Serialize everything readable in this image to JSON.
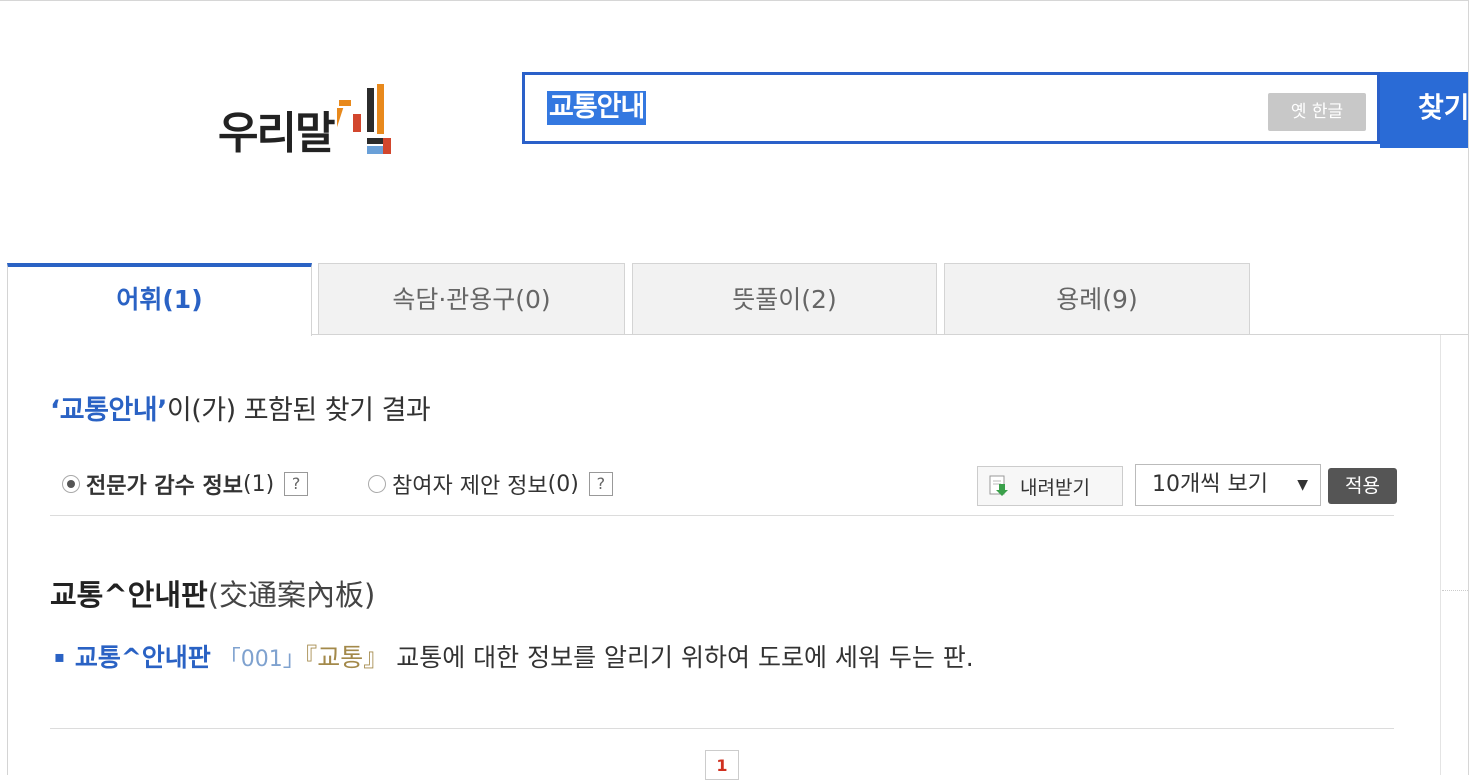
{
  "logo": {
    "text": "우리말",
    "mark_text": "샘"
  },
  "search": {
    "query": "교통안내",
    "old_hangul_label": "옛 한글",
    "button_label": "찾기"
  },
  "tabs": [
    {
      "label": "어휘(1)",
      "active": true
    },
    {
      "label": "속담·관용구(0)",
      "active": false
    },
    {
      "label": "뜻풀이(2)",
      "active": false
    },
    {
      "label": "용례(9)",
      "active": false
    }
  ],
  "result": {
    "query_quoted": "‘교통안내’",
    "heading_suffix": "이(가) 포함된 찾기 결과"
  },
  "filters": {
    "expert": {
      "label": "전문가 감수 정보",
      "count": "(1)",
      "help": "?"
    },
    "participant": {
      "label": "참여자 제안 정보",
      "count": "(0)",
      "help": "?"
    }
  },
  "controls": {
    "download_label": "내려받기",
    "page_size_selected": "10개씩 보기",
    "apply_label": "적용"
  },
  "entry": {
    "word": "교통^안내판",
    "hanja": "(交通案內板)",
    "def_word": "교통^안내판",
    "def_number": "「001」",
    "def_field": "『교통』",
    "definition": "교통에 대한 정보를 알리기 위하여 도로에 세워 두는 판."
  },
  "pagination": {
    "current": "1"
  },
  "colors": {
    "accent": "#2a62c4",
    "search_border": "#2a60c9",
    "search_button": "#2a6bd6",
    "page_active": "#d0301f"
  }
}
